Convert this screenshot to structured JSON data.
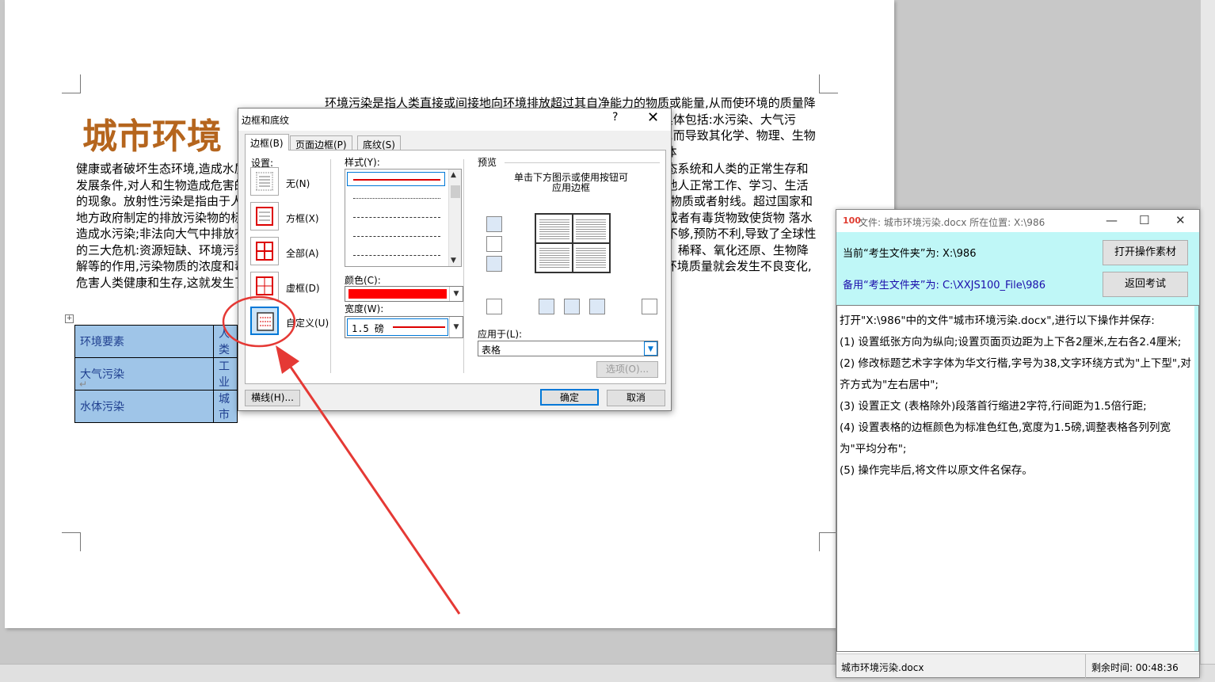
{
  "document": {
    "title": "城市环境",
    "title_right_text": "环境污染是指人类直接或间接地向环境排放超过其自净能力的物质或能量,从而使环境的质量降低,对人类的生存与发展、生态系统和财产造成不利影响的现象。具体包括:水污染、大气污染、噪声污染、放射性污染等。水污染是指水体因某种物质的介入,而导致其化学、物理、生物或者放射性污染等方面特性的改变,从而影响水的有效利用,危害人体",
    "body_text": "健康或者破坏生态环境,造成水质恶化的现象。大气污染是指空气中污染物的浓度达到或超过有害程度,导致破坏生态系统和人类的正常生存和发展条件,对人和生物造成危害的现象。噪声污染是指所产生的环境噪声超过国家规定的环境噪声排放标准,并干扰他人正常工作、学习、生活的现象。放射性污染是指由于人类活动造成物料、人体、场所、环境介质表面或者内部出现超过国家标准的放射性物质或者射线。超过国家和地方政府制定的排放污染物的标准,超种类、超量、超浓度排放污染物;未采取防止溢流和渗漏措施而装载运输油类或者有毒货物致使货物 落水造成水污染;非法向大气中排放有毒有害物质,造成大气环境污染事故等。由于人们对工业高度发达的负面影响预料不够,预防不利,导致了全球性的三大危机:资源短缺、环境污染、生态破坏 。人类不断的向环境排放污染物质。但由于大气、水、土壤等的扩散、稀释、氧化还原、生物降解等的作用,污染物质的浓度和毒性会自然降低,这种现象叫做 环境自净 。如果排放的物质超过了环境的自净能力,环境质量就会发生不良变化,危害人类健康和生存,这就发生了 环境污染 。",
    "table": [
      [
        "环境要素",
        "人类"
      ],
      [
        "大气污染",
        "工业"
      ],
      [
        "水体污染",
        "城市"
      ]
    ],
    "table_handle": "+"
  },
  "dialog": {
    "title": "边框和底纹",
    "help": "?",
    "close": "✕",
    "tabs": [
      "边框(B)",
      "页面边框(P)",
      "底纹(S)"
    ],
    "settings_label": "设置:",
    "settings": [
      "无(N)",
      "方框(X)",
      "全部(A)",
      "虚框(D)",
      "自定义(U)"
    ],
    "style_label": "样式(Y):",
    "color_label": "颜色(C):",
    "color_value": "#ff0000",
    "width_label": "宽度(W):",
    "width_value": "1.5 磅",
    "preview_label": "预览",
    "preview_hint_line1": "单击下方图示或使用按钮可",
    "preview_hint_line2": "应用边框",
    "apply_to_label": "应用于(L):",
    "apply_to_value": "表格",
    "options_button": "选项(O)...",
    "hline_button": "横线(H)...",
    "ok_button": "确定",
    "cancel_button": "取消"
  },
  "side_panel": {
    "title": "文件: 城市环境污染.docx 所在位置: X:\\986",
    "current_folder": "当前“考生文件夹”为: X:\\986",
    "backup_folder": "备用“考生文件夹”为: C:\\XXJS100_File\\986",
    "open_button": "打开操作素材",
    "return_button": "返回考试",
    "instructions": [
      "打开\"X:\\986\"中的文件\"城市环境污染.docx\",进行以下操作并保存:",
      "(1) 设置纸张方向为纵向;设置页面页边距为上下各2厘米,左右各2.4厘米;",
      "(2) 修改标题艺术字字体为华文行楷,字号为38,文字环绕方式为\"上下型\",对齐方式为\"左右居中\";",
      "(3) 设置正文 (表格除外)段落首行缩进2字符,行间距为1.5倍行距;",
      "(4) 设置表格的边框颜色为标准色红色,宽度为1.5磅,调整表格各列列宽为\"平均分布\";",
      "(5) 操作完毕后,将文件以原文件名保存。"
    ],
    "status_file": "城市环境污染.docx",
    "status_time": "剩余时间: 00:48:36",
    "colors": {
      "accent": "#bff7f7",
      "blue_text": "#1a0dab",
      "annotation": "#e53935"
    }
  }
}
